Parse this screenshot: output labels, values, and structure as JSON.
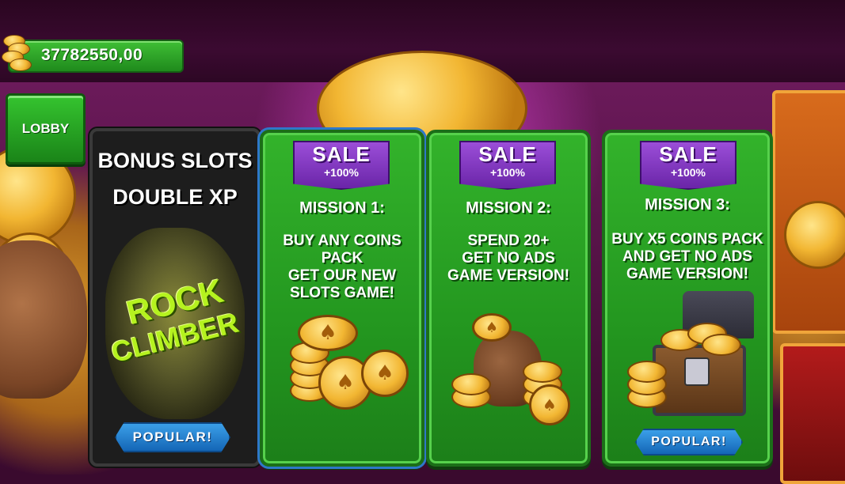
{
  "balance": {
    "amount": "37782550,00",
    "icon": "coin-stack-icon"
  },
  "lobby": {
    "label": "LOBBY"
  },
  "bonus_card": {
    "title_line1": "BONUS SLOTS",
    "title_line2": "DOUBLE XP",
    "game_logo_line1": "ROCK",
    "game_logo_line2": "CLIMBER",
    "badge": "POPULAR!"
  },
  "missions": [
    {
      "sale": "SALE",
      "percent": "+100%",
      "title": "MISSION 1:",
      "description": "BUY ANY COINS\nPACK\nGET OUR NEW\nSLOTS GAME!",
      "art": "coin-pile-icon"
    },
    {
      "sale": "SALE",
      "percent": "+100%",
      "title": "MISSION 2:",
      "description": "SPEND 20+\nGET NO ADS\nGAME VERSION!",
      "art": "coin-bag-icon"
    },
    {
      "sale": "SALE",
      "percent": "+100%",
      "title": "MISSION 3:",
      "description": "BUY X5 COINS PACK\nAND GET NO ADS\nGAME VERSION!",
      "art": "treasure-chest-icon",
      "badge": "POPULAR!"
    }
  ],
  "colors": {
    "accent_green": "#23961f",
    "sale_purple": "#7a2fbd",
    "popular_blue": "#1f7fd1",
    "gold": "#f2b632"
  }
}
